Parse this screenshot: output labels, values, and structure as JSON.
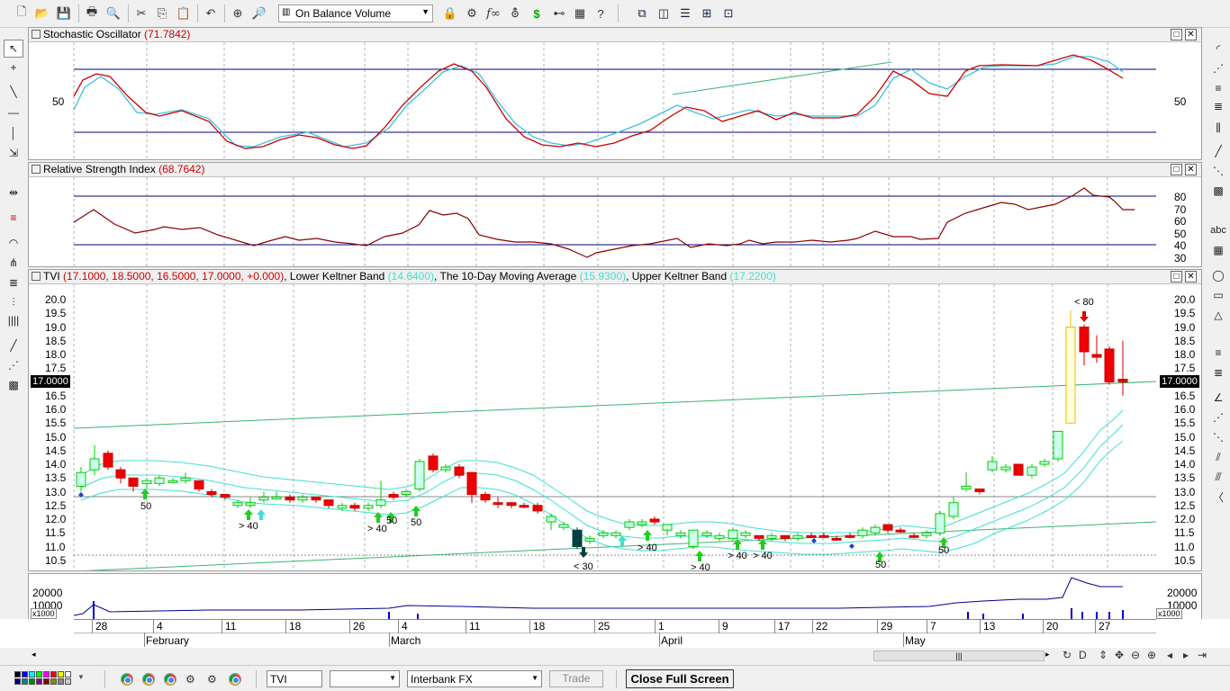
{
  "toolbar": {
    "indicator_select": "On Balance Volume"
  },
  "panes": {
    "stoch": {
      "label": "Stochastic Oscillator",
      "value": "(71.7842)",
      "axis_mid": "50"
    },
    "rsi": {
      "label": "Relative Strength Index",
      "value": "(68.7642)",
      "ticks": [
        "80",
        "70",
        "60",
        "50",
        "40",
        "30"
      ]
    },
    "price": {
      "symbol": "TVI",
      "ohlc": "(17.1000, 18.5000, 16.5000, 17.0000, +0.000)",
      "lower_label": "Lower Keltner Band",
      "lower_value": "(14.6400)",
      "ma_label": "The 10-Day Moving Average",
      "ma_value": "(15.9300)",
      "upper_label": "Upper Keltner Band",
      "upper_value": "(17.2200)",
      "current_price": "17.0000",
      "ticks": [
        "20.0",
        "19.5",
        "19.0",
        "18.5",
        "18.0",
        "17.5",
        "17.0",
        "16.5",
        "16.0",
        "15.5",
        "15.0",
        "14.5",
        "14.0",
        "13.5",
        "13.0",
        "12.5",
        "12.0",
        "11.5",
        "11.0",
        "10.5"
      ]
    },
    "volume": {
      "ticks": [
        "20000",
        "10000"
      ],
      "unit": "x1000"
    }
  },
  "signals": [
    "50",
    "> 40",
    "> 40",
    "50",
    "50",
    "< 30",
    "> 40",
    "> 40",
    "> 40",
    "> 40",
    "50",
    "50",
    "< 80"
  ],
  "xaxis": {
    "days": [
      "28",
      "4",
      "11",
      "18",
      "26",
      "4",
      "11",
      "18",
      "25",
      "1",
      "9",
      "17",
      "22",
      "29",
      "7",
      "13",
      "20",
      "27"
    ],
    "months": [
      "February",
      "March",
      "April",
      "May"
    ]
  },
  "statusbar": {
    "symbol": "TVI",
    "source": "Interbank FX",
    "trade_label": "Trade",
    "close_fullscreen_label": "Close Full Screen"
  },
  "colors": {
    "up": "#00ff00",
    "down": "#ee0000",
    "keltner": "#40e0d0",
    "ma": "#3cb371",
    "h_line": "#000080",
    "stoch_k": "#cc0000",
    "stoch_d": "#40c0e0"
  }
}
